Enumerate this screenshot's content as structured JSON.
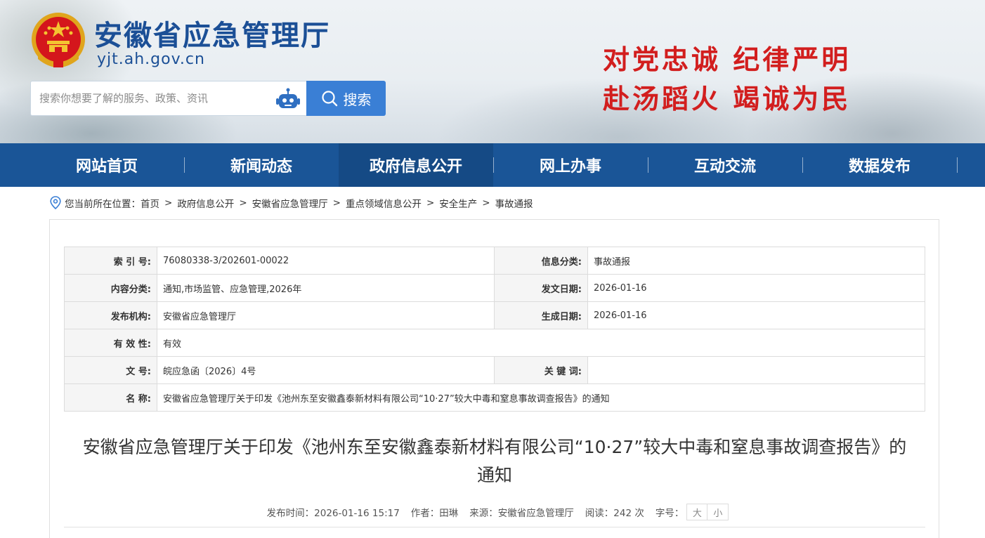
{
  "header": {
    "site_title": "安徽省应急管理厅",
    "site_domain": "yjt.ah.gov.cn",
    "search": {
      "placeholder": "搜索你想要了解的服务、政策、资讯",
      "button_label": "搜索"
    },
    "slogan_line1": "对党忠诚  纪律严明",
    "slogan_line2": "赴汤蹈火  竭诚为民"
  },
  "nav": {
    "items": [
      {
        "label": "网站首页"
      },
      {
        "label": "新闻动态"
      },
      {
        "label": "政府信息公开",
        "active": true
      },
      {
        "label": "网上办事"
      },
      {
        "label": "互动交流"
      },
      {
        "label": "数据发布"
      }
    ]
  },
  "breadcrumb": {
    "prefix": "您当前所在位置：",
    "items": [
      "首页",
      "政府信息公开",
      "安徽省应急管理厅",
      "重点领域信息公开",
      "安全生产",
      "事故通报"
    ],
    "separator": ">"
  },
  "meta_table": {
    "index_label": "索 引 号:",
    "index_value": "76080338-3/202601-00022",
    "category_label": "信息分类:",
    "category_value": "事故通报",
    "content_label": "内容分类:",
    "content_value": "通知,市场监管、应急管理,2026年",
    "issue_date_label": "发文日期:",
    "issue_date_value": "2026-01-16",
    "publisher_label": "发布机构:",
    "publisher_value": "安徽省应急管理厅",
    "gen_date_label": "生成日期:",
    "gen_date_value": "2026-01-16",
    "validity_label": "有 效 性:",
    "validity_value": "有效",
    "docno_label": "文      号:",
    "docno_value": "皖应急函〔2026〕4号",
    "keywords_label": "关 键 词:",
    "keywords_value": "",
    "name_label": "名      称:",
    "name_value": "安徽省应急管理厅关于印发《池州东至安徽鑫泰新材料有限公司“10·27”较大中毒和窒息事故调查报告》的通知"
  },
  "article": {
    "title": "安徽省应急管理厅关于印发《池州东至安徽鑫泰新材料有限公司“10·27”较大中毒和窒息事故调查报告》的通知",
    "publish_time": "发布时间：2026-01-16 15:17",
    "author": "作者：田琳",
    "source": "来源：安徽省应急管理厅",
    "reads": "阅读：242 次",
    "font_size_label": "字号：",
    "font_large": "大",
    "font_small": "小"
  },
  "colors": {
    "brand_blue": "#1a5597",
    "nav_active": "#154a85",
    "search_button": "#3a7fd5",
    "slogan_red": "#d21e1e"
  },
  "icons": [
    "national-emblem-icon",
    "robot-icon",
    "search-icon",
    "location-pin-icon"
  ]
}
